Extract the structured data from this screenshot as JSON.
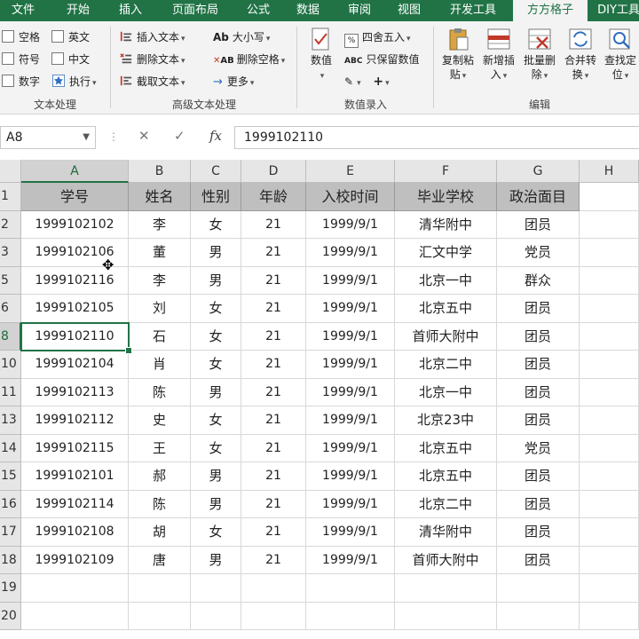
{
  "tabs": [
    "文件",
    "开始",
    "插入",
    "页面布局",
    "公式",
    "数据",
    "审阅",
    "视图",
    "开发工具",
    "方方格子",
    "DIY工具"
  ],
  "ribbon": {
    "text_processing": {
      "items": [
        "空格",
        "英文",
        "符号",
        "中文",
        "数字",
        "执行"
      ],
      "group_label": "文本处理"
    },
    "advanced_text": {
      "items": [
        "插入文本",
        "删除文本",
        "截取文本",
        "大小写",
        "删除空格",
        "更多"
      ],
      "case_glyph": "Ab",
      "trim_glyph": "AB",
      "group_label": "高级文本处理"
    },
    "numeric_entry": {
      "big_button": "数值",
      "items": [
        "四舍五入",
        "只保留数值"
      ],
      "round_glyph": "%",
      "keep_glyph": "ABC",
      "group_label": "数值录入"
    },
    "edit": {
      "buttons": [
        {
          "line1": "复制粘",
          "line2": "贴"
        },
        {
          "line1": "新增插",
          "line2": "入"
        },
        {
          "line1": "批量删",
          "line2": "除"
        },
        {
          "line1": "合并转",
          "line2": "换"
        },
        {
          "line1": "查找定",
          "line2": "位"
        }
      ],
      "group_label": "编辑"
    }
  },
  "formula_bar": {
    "name_box": "A8",
    "cancel_symbol": "✕",
    "enter_symbol": "✓",
    "fx_symbol": "fx",
    "value": "1999102110"
  },
  "sheet": {
    "columns": [
      "A",
      "B",
      "C",
      "D",
      "E",
      "F",
      "G",
      "H"
    ],
    "selected_column": "A",
    "headers": [
      "学号",
      "姓名",
      "性别",
      "年龄",
      "入校时间",
      "毕业学校",
      "政治面目"
    ],
    "rows": [
      {
        "num": "1",
        "cells": null
      },
      {
        "num": "2",
        "cells": [
          "1999102102",
          "李",
          "女",
          "21",
          "1999/9/1",
          "清华附中",
          "团员"
        ]
      },
      {
        "num": "3",
        "cells": [
          "1999102106",
          "董",
          "男",
          "21",
          "1999/9/1",
          "汇文中学",
          "党员"
        ]
      },
      {
        "num": "5",
        "cells": [
          "1999102116",
          "李",
          "男",
          "21",
          "1999/9/1",
          "北京一中",
          "群众"
        ]
      },
      {
        "num": "6",
        "cells": [
          "1999102105",
          "刘",
          "女",
          "21",
          "1999/9/1",
          "北京五中",
          "团员"
        ]
      },
      {
        "num": "8",
        "cells": [
          "1999102110",
          "石",
          "女",
          "21",
          "1999/9/1",
          "首师大附中",
          "团员"
        ]
      },
      {
        "num": "10",
        "cells": [
          "1999102104",
          "肖",
          "女",
          "21",
          "1999/9/1",
          "北京二中",
          "团员"
        ]
      },
      {
        "num": "11",
        "cells": [
          "1999102113",
          "陈",
          "男",
          "21",
          "1999/9/1",
          "北京一中",
          "团员"
        ]
      },
      {
        "num": "13",
        "cells": [
          "1999102112",
          "史",
          "女",
          "21",
          "1999/9/1",
          "北京23中",
          "团员"
        ]
      },
      {
        "num": "14",
        "cells": [
          "1999102115",
          "王",
          "女",
          "21",
          "1999/9/1",
          "北京五中",
          "党员"
        ]
      },
      {
        "num": "15",
        "cells": [
          "1999102101",
          "郝",
          "男",
          "21",
          "1999/9/1",
          "北京五中",
          "团员"
        ]
      },
      {
        "num": "16",
        "cells": [
          "1999102114",
          "陈",
          "男",
          "21",
          "1999/9/1",
          "北京二中",
          "团员"
        ]
      },
      {
        "num": "17",
        "cells": [
          "1999102108",
          "胡",
          "女",
          "21",
          "1999/9/1",
          "清华附中",
          "团员"
        ]
      },
      {
        "num": "18",
        "cells": [
          "1999102109",
          "唐",
          "男",
          "21",
          "1999/9/1",
          "首师大附中",
          "团员"
        ]
      },
      {
        "num": "19",
        "cells": []
      },
      {
        "num": "20",
        "cells": []
      }
    ],
    "selected_row": "8",
    "active_cell": "A8"
  },
  "colors": {
    "accent": "#217346",
    "header_fill": "#bfbfbf"
  }
}
